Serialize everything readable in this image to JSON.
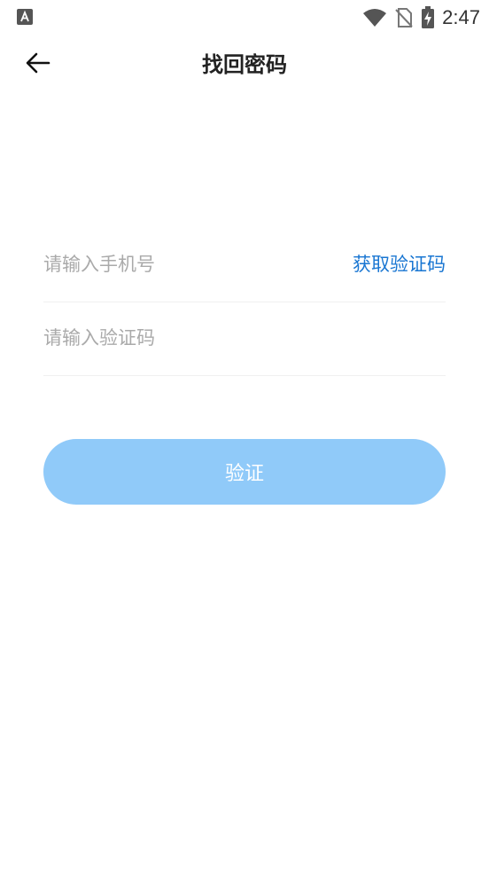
{
  "status_bar": {
    "left_icon": "font-a-icon",
    "icons": [
      "wifi-icon",
      "no-sim-icon",
      "battery-charging-icon"
    ],
    "time": "2:47"
  },
  "header": {
    "back_icon": "arrow-left-icon",
    "title": "找回密码"
  },
  "form": {
    "phone": {
      "value": "",
      "placeholder": "请输入手机号"
    },
    "get_code_label": "获取验证码",
    "code": {
      "value": "",
      "placeholder": "请输入验证码"
    },
    "submit_label": "验证"
  },
  "colors": {
    "link": "#1976d2",
    "button_disabled": "#90caf9",
    "placeholder": "#aaaaaa",
    "title": "#222222"
  }
}
